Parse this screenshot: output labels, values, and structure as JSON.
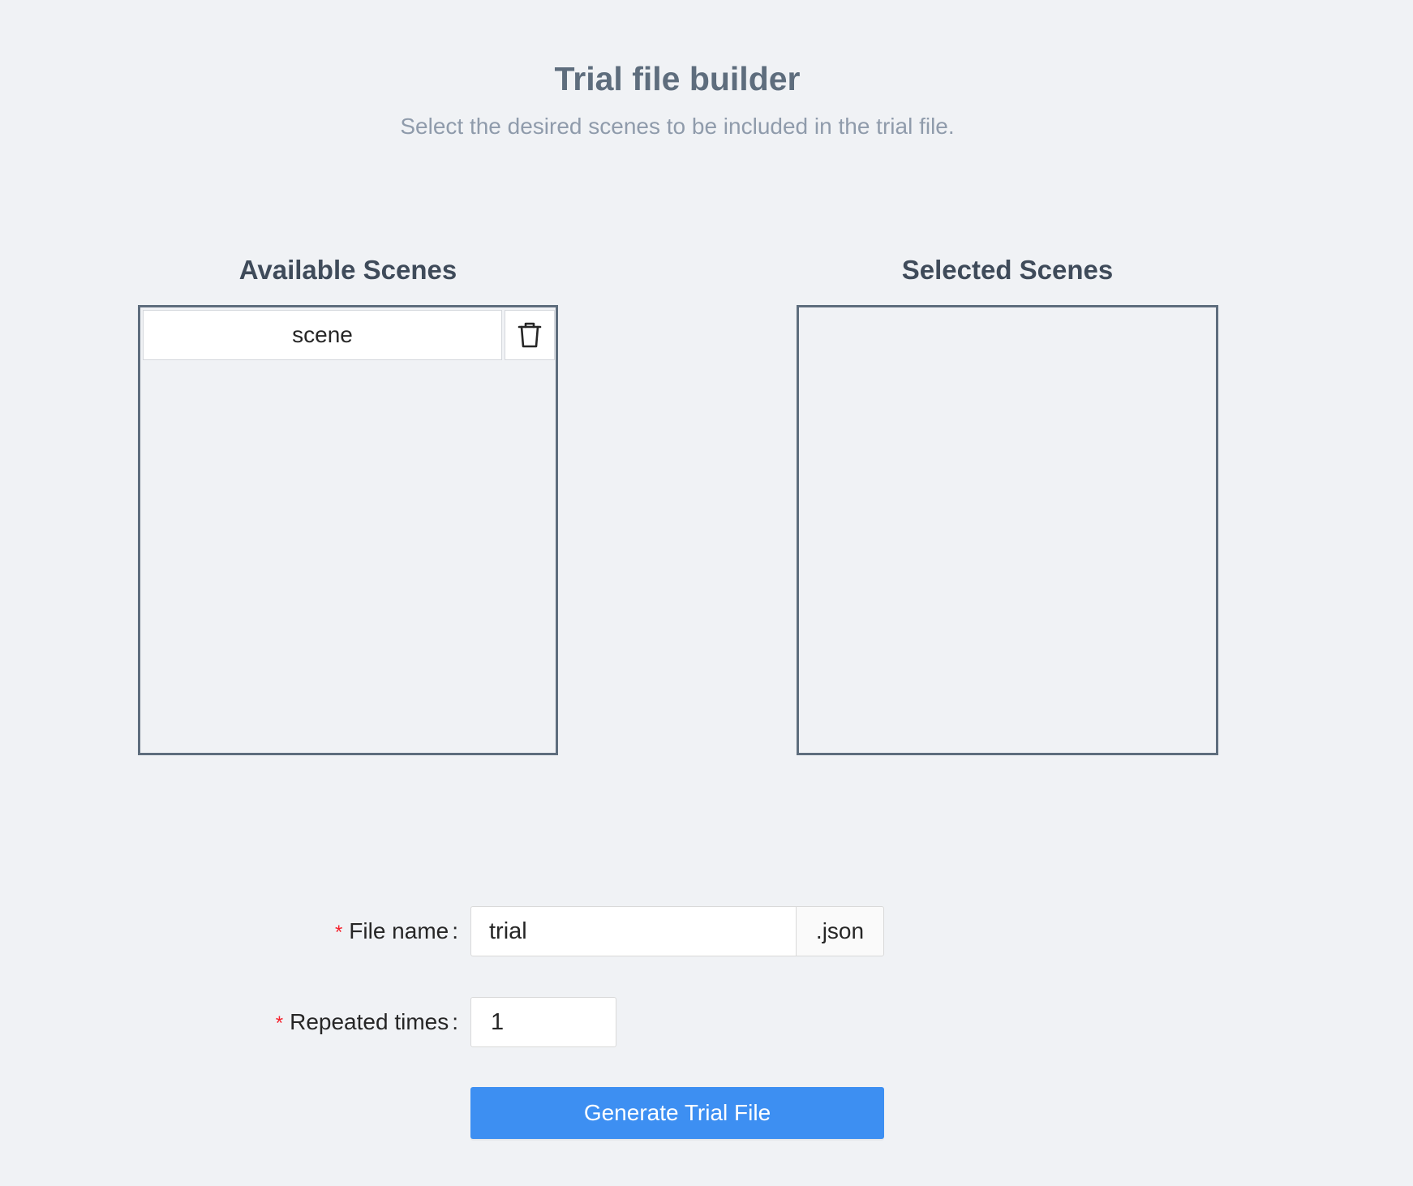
{
  "header": {
    "title": "Trial file builder",
    "subtitle": "Select the desired scenes to be included in the trial file."
  },
  "available": {
    "heading": "Available Scenes",
    "items": [
      {
        "label": "scene",
        "action_icon": "trash-icon"
      }
    ]
  },
  "selected": {
    "heading": "Selected Scenes",
    "items": []
  },
  "form": {
    "file_name": {
      "required_mark": "*",
      "label": "File name",
      "colon": ":",
      "value": "trial",
      "suffix": ".json"
    },
    "repeated_times": {
      "required_mark": "*",
      "label": "Repeated times",
      "colon": ":",
      "value": "1"
    },
    "submit_label": "Generate Trial File"
  },
  "colors": {
    "primary": "#3d8ff2",
    "required": "#f5222d",
    "box_border": "#5e6d7d",
    "background": "#f0f2f5"
  }
}
